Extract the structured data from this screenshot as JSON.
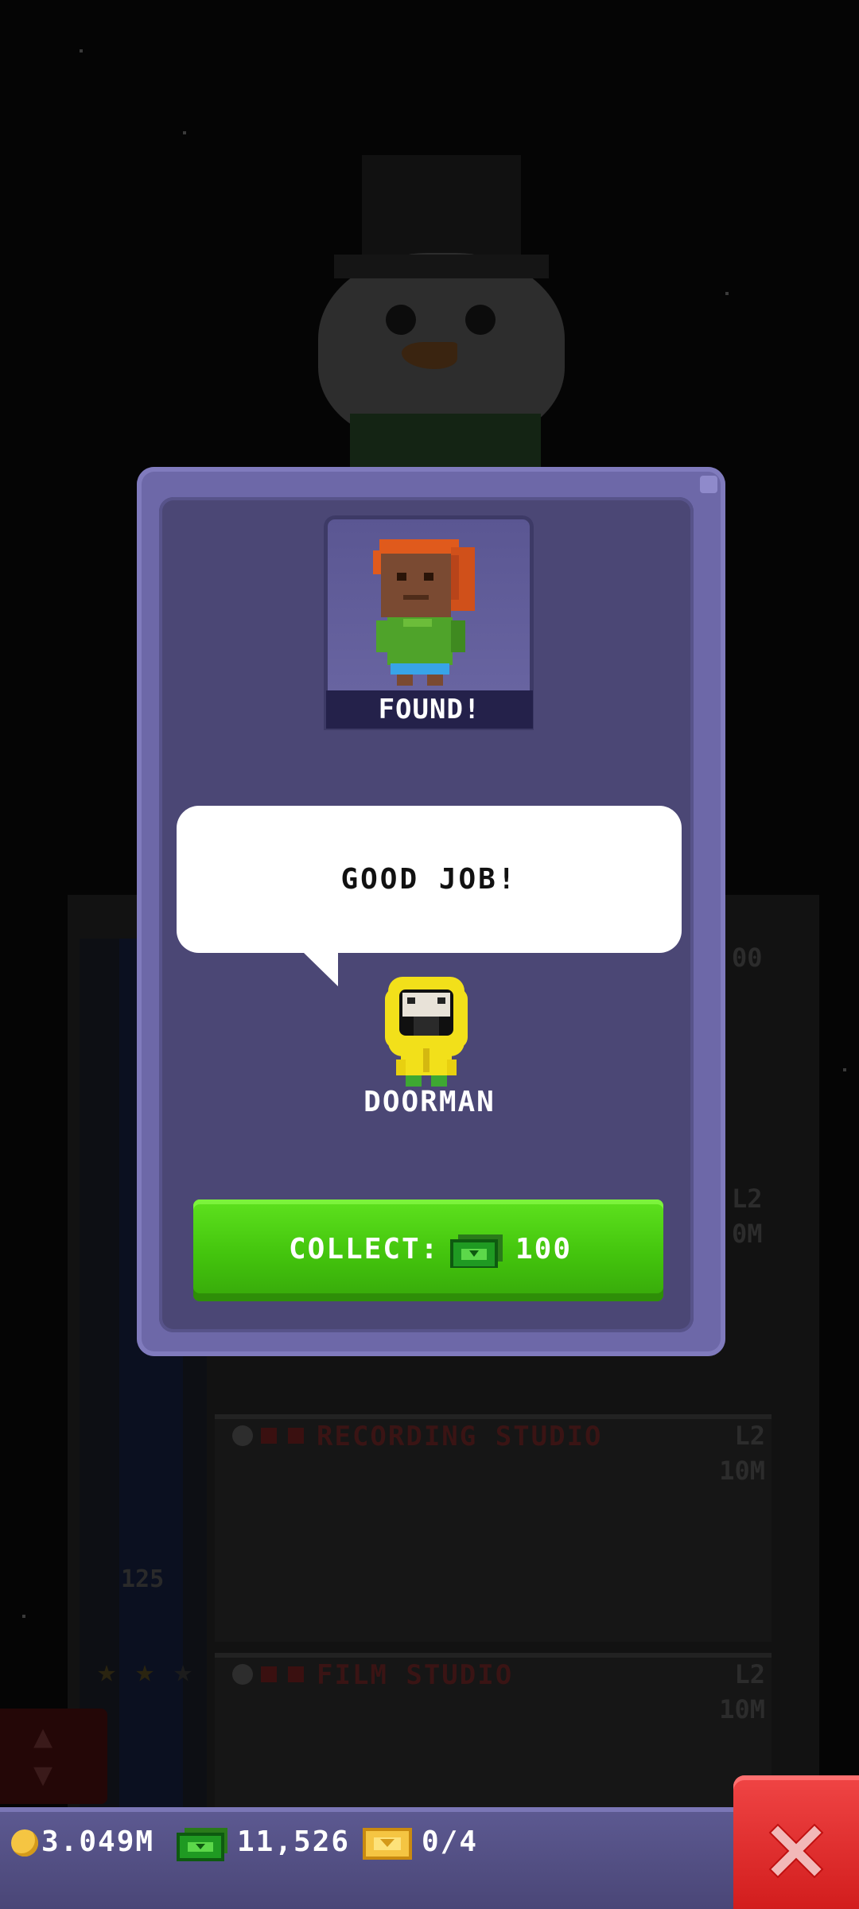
{
  "popup": {
    "found_label": "FOUND!",
    "speech": "GOOD JOB!",
    "npc_name": "DOORMAN",
    "collect_label": "COLLECT:",
    "collect_amount": "100",
    "collect_currency_icon": "bux-icon"
  },
  "background": {
    "floors": [
      {
        "title": "RECORDING STUDIO",
        "level": "L2",
        "time": "10M"
      },
      {
        "title": "FILM STUDIO",
        "level": "L2",
        "time": "10M"
      }
    ],
    "floor_numbers": [
      "125"
    ],
    "partial_level": "L2",
    "partial_time": "0M",
    "partial_top": "00"
  },
  "status_bar": {
    "coins": "3.049M",
    "bux": "11,526",
    "tickets": "0/4"
  },
  "colors": {
    "popup_frame": "#6d68a8",
    "popup_inner": "#4b4775",
    "collect_green": "#43c40d",
    "close_red": "#d21d1d",
    "coin_gold": "#f5c542"
  }
}
